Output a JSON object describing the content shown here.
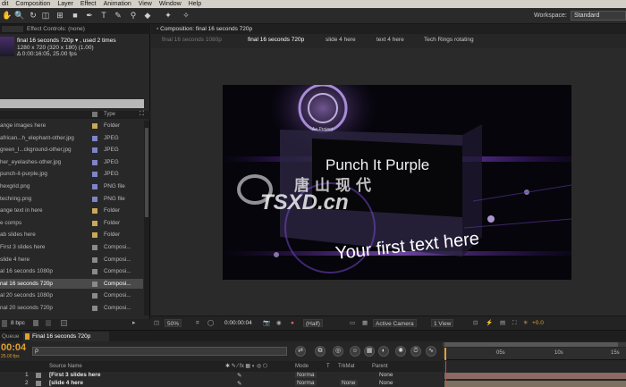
{
  "menu": [
    "dit",
    "Composition",
    "Layer",
    "Effect",
    "Animation",
    "View",
    "Window",
    "Help"
  ],
  "workspace": {
    "label": "Workspace:",
    "value": "Standard"
  },
  "left_tabs": {
    "effect_controls": "Effect Controls: (none)"
  },
  "project": {
    "name": "final 16 seconds 720p ▾ , used 2 times",
    "size": "1280 x 720  (320 x 180) (1.00)",
    "duration": "Δ 0:00:16:05, 25.00 fps",
    "type_header": "Type",
    "items": [
      {
        "name": "ange images here",
        "type": "Folder",
        "color": "#c8a85a"
      },
      {
        "name": "african...h_elephant-other.jpg",
        "type": "JPEG",
        "color": "#7e84c8"
      },
      {
        "name": "green_l...ckground-other.jpg",
        "type": "JPEG",
        "color": "#7e84c8"
      },
      {
        "name": "her_eyelashes-other.jpg",
        "type": "JPEG",
        "color": "#7e84c8"
      },
      {
        "name": "punch-it-purple.jpg",
        "type": "JPEG",
        "color": "#7e84c8"
      },
      {
        "name": "hexgrid.png",
        "type": "PNG file",
        "color": "#7e84c8"
      },
      {
        "name": "techring.png",
        "type": "PNG file",
        "color": "#7e84c8"
      },
      {
        "name": "ange text in here",
        "type": "Folder",
        "color": "#c8a85a"
      },
      {
        "name": "e comps",
        "type": "Folder",
        "color": "#c8a85a"
      },
      {
        "name": "ab slides here",
        "type": "Folder",
        "color": "#c8a85a"
      },
      {
        "name": "First 3 slides here",
        "type": "Composi...",
        "color": "#8a8a8a"
      },
      {
        "name": "slide 4 here",
        "type": "Composi...",
        "color": "#8a8a8a"
      },
      {
        "name": "al 16 seconds 1080p",
        "type": "Composi...",
        "color": "#8a8a8a"
      },
      {
        "name": "nal 16 seconds 720p",
        "type": "Composi...",
        "color": "#8a8a8a"
      },
      {
        "name": "al 20 seconds 1080p",
        "type": "Composi...",
        "color": "#8a8a8a"
      },
      {
        "name": "nal 20 seconds 720p",
        "type": "Composi...",
        "color": "#8a8a8a"
      }
    ],
    "bpc": "8 bpc"
  },
  "composition": {
    "tab": "Composition: final 16 seconds 720p",
    "subtabs": [
      "final 16 seconds 1080p",
      "final 16 seconds 720p",
      "slide 4 here",
      "text 4 here",
      "Tech Rings rotating"
    ],
    "frame_text_title": "Punch It Purple",
    "frame_text_sub": "Your first text here",
    "frame_small_label": "Ae Project",
    "watermark_cn": "唐山现代",
    "watermark_en": "TSXD.cn",
    "viewer_bar": {
      "zoom": "50%",
      "timecode": "0:00:00:04",
      "resolution": "(Half)",
      "camera": "Active Camera",
      "view": "1 View",
      "exposure": "+0.0"
    }
  },
  "timeline": {
    "tab_queue": "Queue",
    "tab_comp": "Final 16 seconds 720p",
    "timecode": "00:04",
    "fps": "25.00 fps",
    "search_placeholder": "ρ",
    "columns": {
      "source": "Source Name",
      "mode": "Mode",
      "t": "T",
      "trkmat": "TrkMat",
      "parent": "Parent"
    },
    "ruler": [
      "05s",
      "10s",
      "15s"
    ],
    "layers": [
      {
        "num": "1",
        "name": "[First 3 slides here",
        "mode": "Norma",
        "parent": "None"
      },
      {
        "num": "2",
        "name": "[slide 4 here",
        "mode": "Norma",
        "trkmat": "None",
        "parent": "None"
      }
    ]
  },
  "colors": {
    "accent_purple": "#8a3cff",
    "timecode_orange": "#e0a030",
    "bar_red": "#8a6a62",
    "bar_olive": "#7c7160"
  }
}
